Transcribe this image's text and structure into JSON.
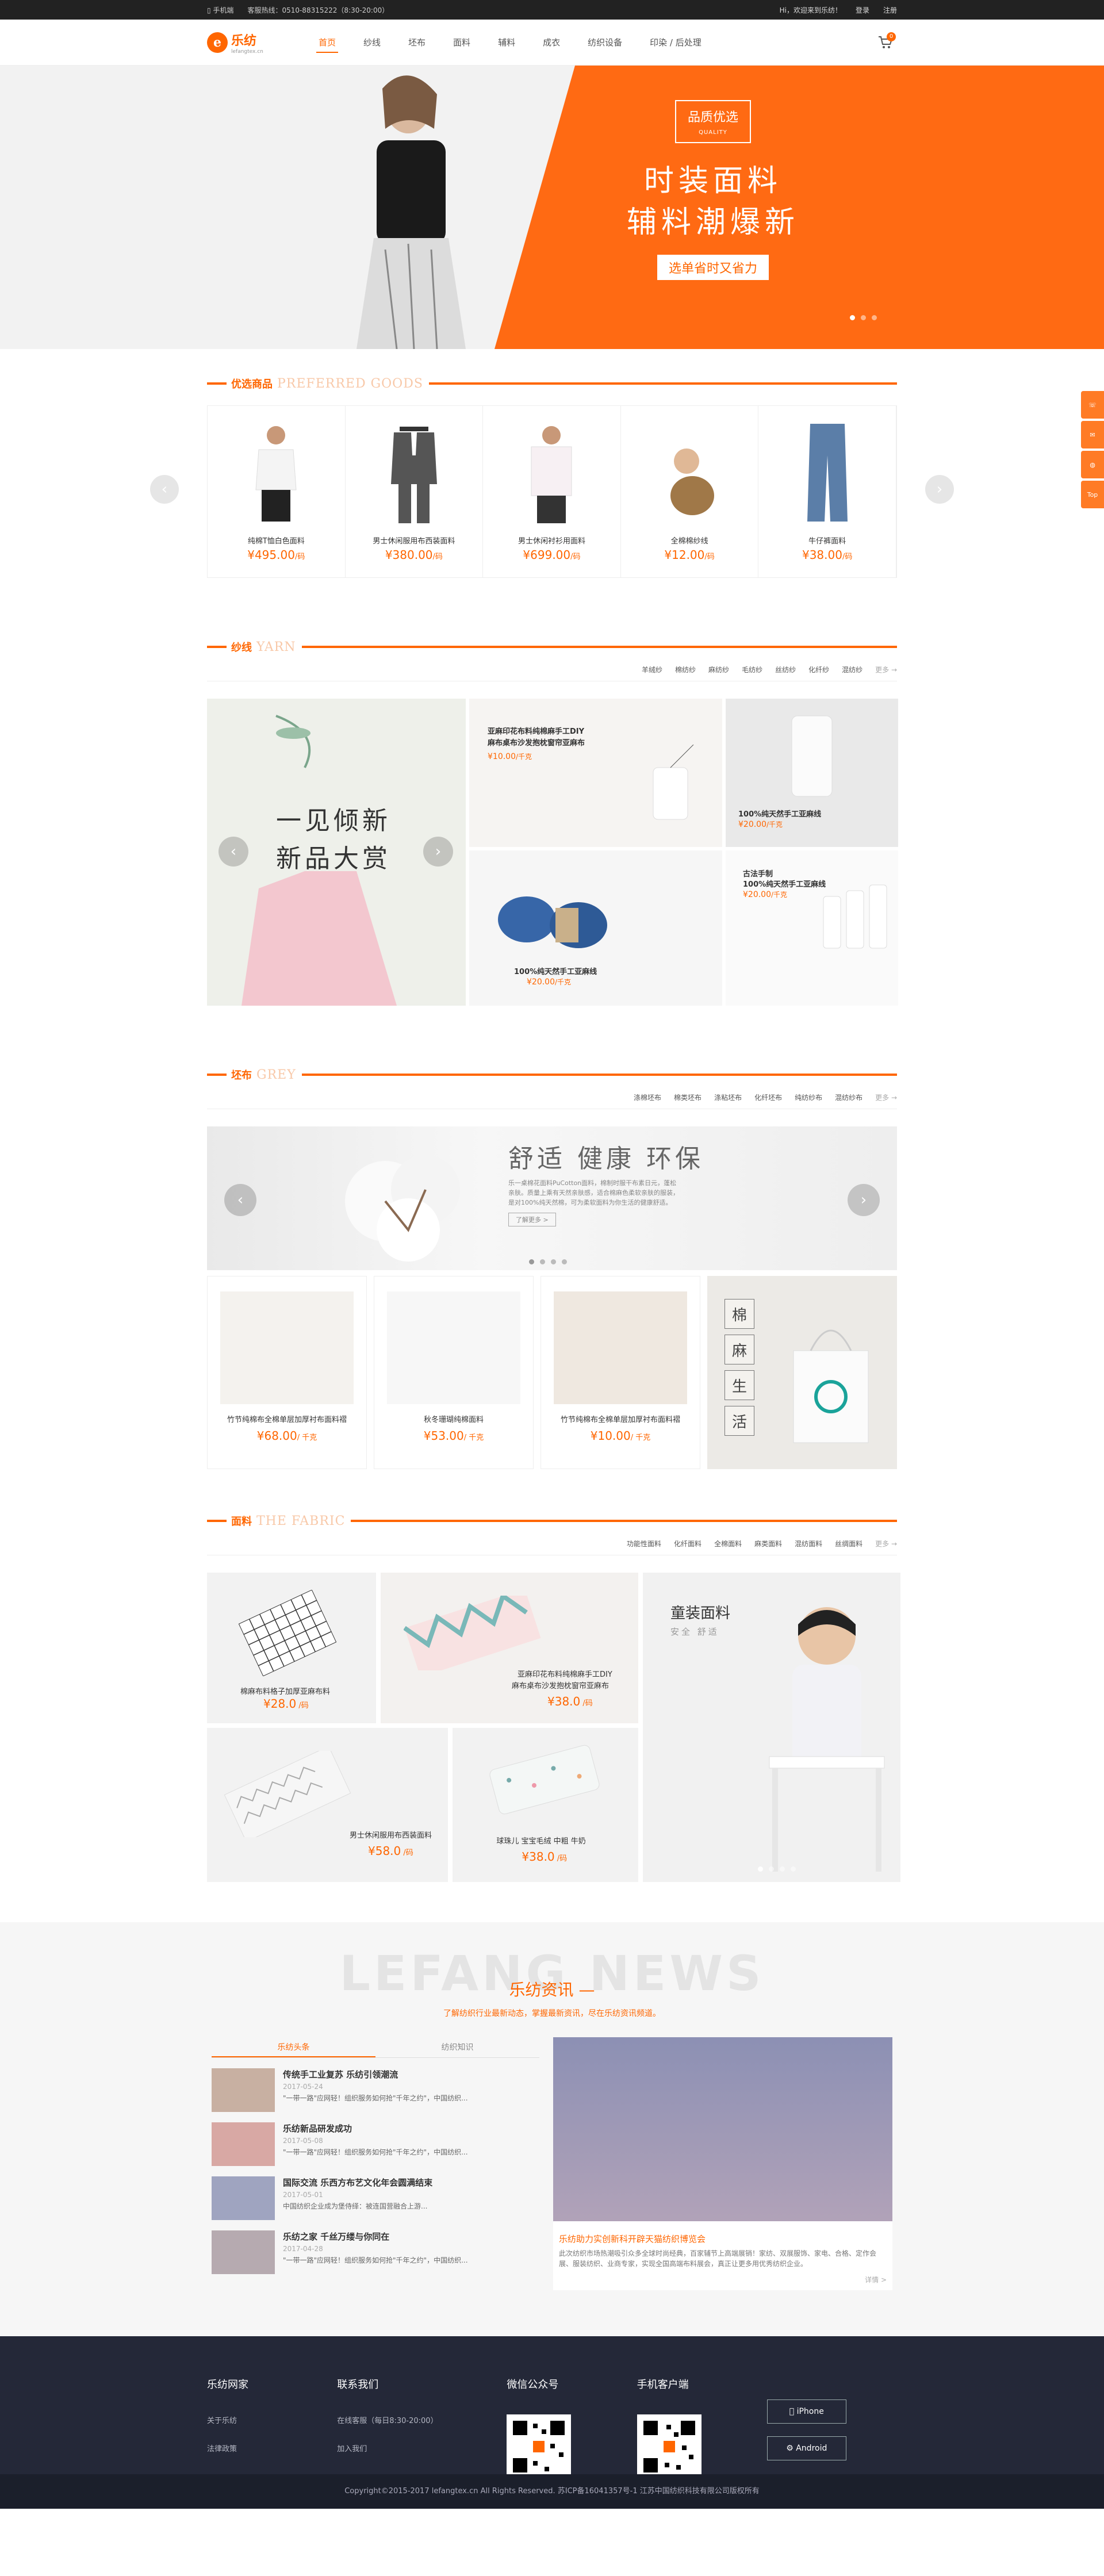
{
  "topbar": {
    "mobile": "手机端",
    "hotline": "客服热线：0510-88315222（8:30-20:00）",
    "welcome": "Hi，欢迎来到乐纺！",
    "login": "登录",
    "register": "注册"
  },
  "brand": {
    "name": "乐纺",
    "sub": "lefangtex.cn"
  },
  "nav": [
    "首页",
    "纱线",
    "坯布",
    "面料",
    "辅料",
    "成衣",
    "纺织设备",
    "印染 / 后处理"
  ],
  "cart_count": "0",
  "banner": {
    "quality_cn": "品质优选",
    "quality_en": "QUALITY",
    "line1": "时装面料",
    "line2": "辅料潮爆新",
    "tag": "选单省时又省力"
  },
  "side": [
    "",
    "",
    "",
    "Top"
  ],
  "preferred": {
    "title_cn": "优选商品",
    "title_en": "PREFERRED GOODS",
    "items": [
      {
        "name": "纯棉T恤白色面料",
        "price": "¥495.00",
        "unit": "/码"
      },
      {
        "name": "男士休闲服用布西装面料",
        "price": "¥380.00",
        "unit": "/码"
      },
      {
        "name": "男士休闲衬衫用面料",
        "price": "¥699.00",
        "unit": "/码"
      },
      {
        "name": "全棉棉纱线",
        "price": "¥12.00",
        "unit": "/码"
      },
      {
        "name": "牛仔裤面料",
        "price": "¥38.00",
        "unit": "/码"
      }
    ]
  },
  "yarn": {
    "title_cn": "纱线",
    "title_en": "YARN",
    "tabs": [
      "羊绒纱",
      "棉纺纱",
      "麻纺纱",
      "毛纺纱",
      "丝纺纱",
      "化纤纱",
      "混纺纱"
    ],
    "more": "更多 →",
    "big": [
      "一见倾新",
      "新品大赏"
    ],
    "items": [
      {
        "name1": "亚麻印花布料纯棉麻手工DIY",
        "name2": "麻布桌布沙发抱枕窗帘亚麻布",
        "price": "¥10.00",
        "unit": "/千克"
      },
      {
        "name1": "100%纯天然手工亚麻线",
        "name2": "",
        "price": "¥20.00",
        "unit": "/千克"
      },
      {
        "name1": "100%纯天然手工亚麻线",
        "name2": "",
        "price": "¥20.00",
        "unit": "/千克"
      },
      {
        "name1": "古法手制",
        "name2": "100%纯天然手工亚麻线",
        "price": "¥20.00",
        "unit": "/千克"
      }
    ]
  },
  "grey": {
    "title_cn": "坯布",
    "title_en": "GREY",
    "tabs": [
      "涤棉坯布",
      "棉类坯布",
      "涤粘坯布",
      "化纤坯布",
      "纯纺纱布",
      "混纺纱布"
    ],
    "more": "更多 →",
    "banner_head": "舒适 健康 环保",
    "banner_desc": "乐一桌棉花面料PuCotton面料，棉制时服干布素日元，蓬松亲肤。质量上乘有天然亲肤感，适合棉麻色柔软亲肤的服装，是对100%纯天然棉，可为柔软面料为你生活的健康舒适。",
    "banner_btn": "了解更多 >",
    "items": [
      {
        "name": "竹节纯棉布全棉单层加厚衬布面料褶",
        "price": "¥68.00",
        "unit": "/ 千克"
      },
      {
        "name": "秋冬珊瑚纯棉面料",
        "price": "¥53.00",
        "unit": "/ 千克"
      },
      {
        "name": "竹节纯棉布全棉单层加厚衬布面料褶",
        "price": "¥10.00",
        "unit": "/ 千克"
      }
    ],
    "side": [
      "棉",
      "麻",
      "生",
      "活"
    ]
  },
  "fabric": {
    "title_cn": "面料",
    "title_en": "THE FABRIC",
    "tabs": [
      "功能性面料",
      "化纤面料",
      "全棉面料",
      "麻类面料",
      "混纺面料",
      "丝绸面料"
    ],
    "more": "更多 →",
    "items": [
      {
        "name": "棉麻布料格子加厚亚麻布料",
        "price": "¥28.0",
        "unit": " /码"
      },
      {
        "name1": "亚麻印花布料纯棉麻手工DIY",
        "name2": "麻布桌布沙发抱枕窗帘亚麻布",
        "price": "¥38.0",
        "unit": " /码"
      },
      {
        "name": "男士休闲服用布西装面料",
        "price": "¥58.0",
        "unit": " /码"
      },
      {
        "name": "球珠儿 宝宝毛绒 中粗 牛奶",
        "price": "¥38.0",
        "unit": " /码"
      }
    ],
    "kid_title": "童装面料",
    "kid_sub": "安全 舒适"
  },
  "news": {
    "en": "LEFANG NEWS",
    "cn": "乐纺资讯 —",
    "sub": "了解纺织行业最新动态，掌握最新资讯，尽在乐纺资讯频道。",
    "tabs": [
      "乐纺头条",
      "纺织知识"
    ],
    "items": [
      {
        "title": "传统手工业复苏 乐纺引领潮流",
        "date": "2017-05-24",
        "ex": "\"一带一路\"应网轻！组织服务如何抢\"千年之约\"，中国纺织..."
      },
      {
        "title": "乐纺新品研发成功",
        "date": "2017-05-08",
        "ex": "\"一带一路\"应网轻！组织服务如何抢\"千年之约\"，中国纺织..."
      },
      {
        "title": "国际交流 乐西方布艺文化年会圆满结束",
        "date": "2017-05-01",
        "ex": "中国纺织企业成为堡侍绎：被连国营融合上游..."
      },
      {
        "title": "乐纺之家 千丝万缕与你同在",
        "date": "2017-04-28",
        "ex": "\"一带一路\"应网轻！组织服务如何抢\"千年之约\"，中国纺织..."
      }
    ],
    "feature_title": "乐纺助力实创新科开辟天猫纺织博览会",
    "feature_ex": "此次纺织市场热潮吸引众多全球时尚经典，百家辅节上高端展销！家纺、双展服饰、家电、合格、定作会展、服装纺织、业商专家，实现全国高端布料展会，真正让更多用优秀纺织企业。",
    "more": "详情 >"
  },
  "footer": {
    "c1_title": "乐纺网家",
    "c1_links": [
      "关于乐纺",
      "法律政策"
    ],
    "c2_title": "联系我们",
    "c2_links": [
      "在线客服（每日8:30-20:00）",
      "加入我们"
    ],
    "c3_title": "微信公众号",
    "c4_title": "手机客户端",
    "iphone": "iPhone",
    "android": "Android",
    "copyright": "Copyright©2015-2017 lefangtex.cn  All Rights Reserved.     苏ICP备16041357号-1     江苏中国纺织科技有限公司版权所有"
  },
  "colors": {
    "accent": "#ff6a13",
    "footer": "#242838"
  }
}
